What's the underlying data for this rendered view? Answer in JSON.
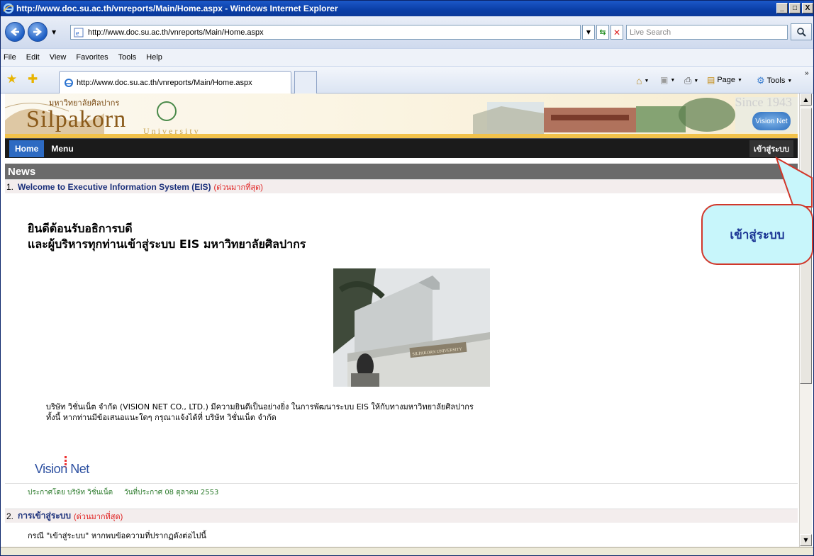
{
  "window": {
    "title": "http://www.doc.su.ac.th/vnreports/Main/Home.aspx - Windows Internet Explorer",
    "caption_buttons": [
      "_",
      "□",
      "X"
    ]
  },
  "toolbar": {
    "address": "http://www.doc.su.ac.th/vnreports/Main/Home.aspx",
    "search_placeholder": "Live Search"
  },
  "menubar": {
    "items": [
      "File",
      "Edit",
      "View",
      "Favorites",
      "Tools",
      "Help"
    ]
  },
  "favbar": {
    "tab_title": "http://www.doc.su.ac.th/vnreports/Main/Home.aspx",
    "page_label": "Page",
    "tools_label": "Tools"
  },
  "site": {
    "logo_text": "Silpakorn",
    "logo_thai": "มหาวิทยาลัยศิลปากร",
    "logo_univ": "University",
    "since": "Since 1943",
    "brand_badge": "Vision Net",
    "nav": {
      "home": "Home",
      "menu": "Menu",
      "login": "เข้าสู่ระบบ"
    },
    "news_title": "News"
  },
  "news": {
    "items": [
      {
        "num": "1.",
        "title": "Welcome to Executive Information System (EIS)",
        "urgency": "(ด่วนมากที่สุด)"
      },
      {
        "num": "2.",
        "title": "การเข้าสู่ระบบ",
        "urgency": "(ด่วนมากที่สุด)"
      }
    ],
    "welcome_line1": "ยินดีต้อนรับอธิการบดี",
    "welcome_line2": "และผู้บริหารทุกท่านเข้าสู่ระบบ EIS มหาวิทยาลัยศิลปากร",
    "body_line1": "บริษัท วิชั่นเน็ต จำกัด (VISION NET CO., LTD.) มีความยินดีเป็นอย่างยิ่ง ในการพัฒนาระบบ EIS ให้กับทางมหาวิทยาลัยศิลปากร",
    "body_line2": "ทั้งนี้ หากท่านมีข้อเสนอแนะใดๆ กรุณาแจ้งได้ที่ บริษัท วิชั่นเน็ต จำกัด",
    "vision_logo": "Vision Net",
    "posted_by": "ประกาศโดย  บริษัท วิชั่นเน็ต",
    "posted_date": "วันที่ประกาศ  08 ตุลาคม 2553",
    "item2_text": "กรณี \"เข้าสู่ระบบ\" หากพบข้อความที่ปรากฏดังต่อไปนี้",
    "photo_sign": "SILPAKORN UNIVERSITY"
  },
  "callout": {
    "text": "เข้าสู่ระบบ"
  },
  "colors": {
    "title_bar": "#0a3ea6",
    "nav_home": "#2d6ac2",
    "news_bar": "#6b6b6b",
    "item_title": "#1a2f7a",
    "urgent": "#e02020",
    "callout_fill": "#c8f6fb",
    "callout_border": "#d1372a"
  }
}
